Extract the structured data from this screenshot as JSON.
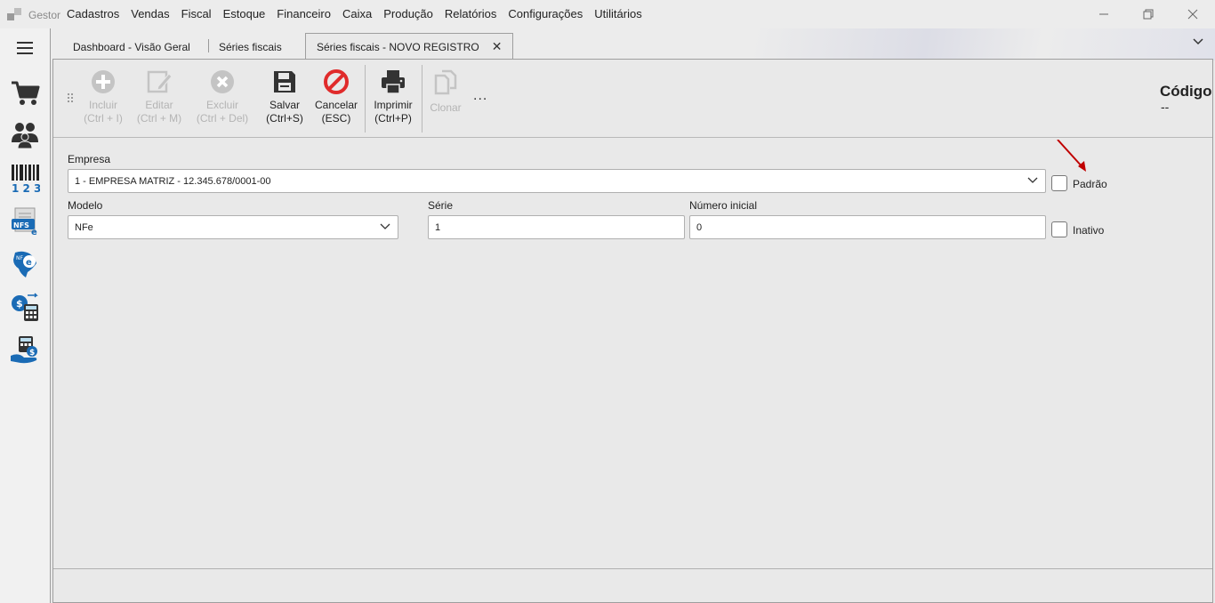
{
  "app": {
    "name": "Gestor"
  },
  "menu": [
    "Cadastros",
    "Vendas",
    "Fiscal",
    "Estoque",
    "Financeiro",
    "Caixa",
    "Produção",
    "Relatórios",
    "Configurações",
    "Utilitários"
  ],
  "tabs": [
    {
      "label": "Dashboard - Visão Geral"
    },
    {
      "label": "Séries fiscais"
    },
    {
      "label": "Séries fiscais - NOVO REGISTRO",
      "active": true
    }
  ],
  "toolbar": {
    "incluir": {
      "line1": "Incluir",
      "line2": "(Ctrl + I)"
    },
    "editar": {
      "line1": "Editar",
      "line2": "(Ctrl + M)"
    },
    "excluir": {
      "line1": "Excluir",
      "line2": "(Ctrl + Del)"
    },
    "salvar": {
      "line1": "Salvar",
      "line2": "(Ctrl+S)"
    },
    "cancelar": {
      "line1": "Cancelar",
      "line2": "(ESC)"
    },
    "imprimir": {
      "line1": "Imprimir",
      "line2": "(Ctrl+P)"
    },
    "clonar": {
      "line1": "Clonar"
    },
    "more": "..."
  },
  "codigo": {
    "label": "Código",
    "value": "--"
  },
  "form": {
    "empresa": {
      "label": "Empresa",
      "value": "1 - EMPRESA MATRIZ - 12.345.678/0001-00"
    },
    "padrao": {
      "label": "Padrão",
      "checked": false
    },
    "modelo": {
      "label": "Modelo",
      "value": "NFe"
    },
    "serie": {
      "label": "Série",
      "value": "1"
    },
    "numero_inicial": {
      "label": "Número inicial",
      "value": "0"
    },
    "inativo": {
      "label": "Inativo",
      "checked": false
    }
  },
  "colors": {
    "cancel_red": "#e02b2b",
    "icon_dark": "#333333",
    "arrow_red": "#c00000",
    "rail_blue": "#1a6bb5"
  }
}
